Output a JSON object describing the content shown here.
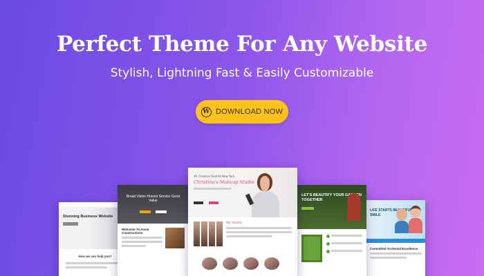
{
  "headline": "Perfect Theme For Any Website",
  "subheadline": "Stylish, Lightning Fast & Easily Customizable",
  "cta": {
    "label": "DOWNLOAD NOW",
    "icon": "wordpress-icon"
  },
  "colors": {
    "bg_start": "#6a4be2",
    "bg_end": "#c96cf2",
    "cta": "#ffc21a"
  },
  "previews": [
    {
      "title": "Stunning Business Website",
      "help": "How we can help you?"
    },
    {
      "title": "Broad Vision Honest Service Great Value",
      "section": "Welcome To Acme Constructions"
    },
    {
      "kicker": "#1 Creative Dentist New York",
      "title": "Christina's Makeup Studio",
      "about": "My Studio"
    },
    {
      "title": "LET'S BEAUTIFY YOUR GARDEN TOGETHER"
    },
    {
      "title": "LIFE STARTS BEAUTIFUL SMILE",
      "section": "Committed To Dental Excellence"
    }
  ]
}
